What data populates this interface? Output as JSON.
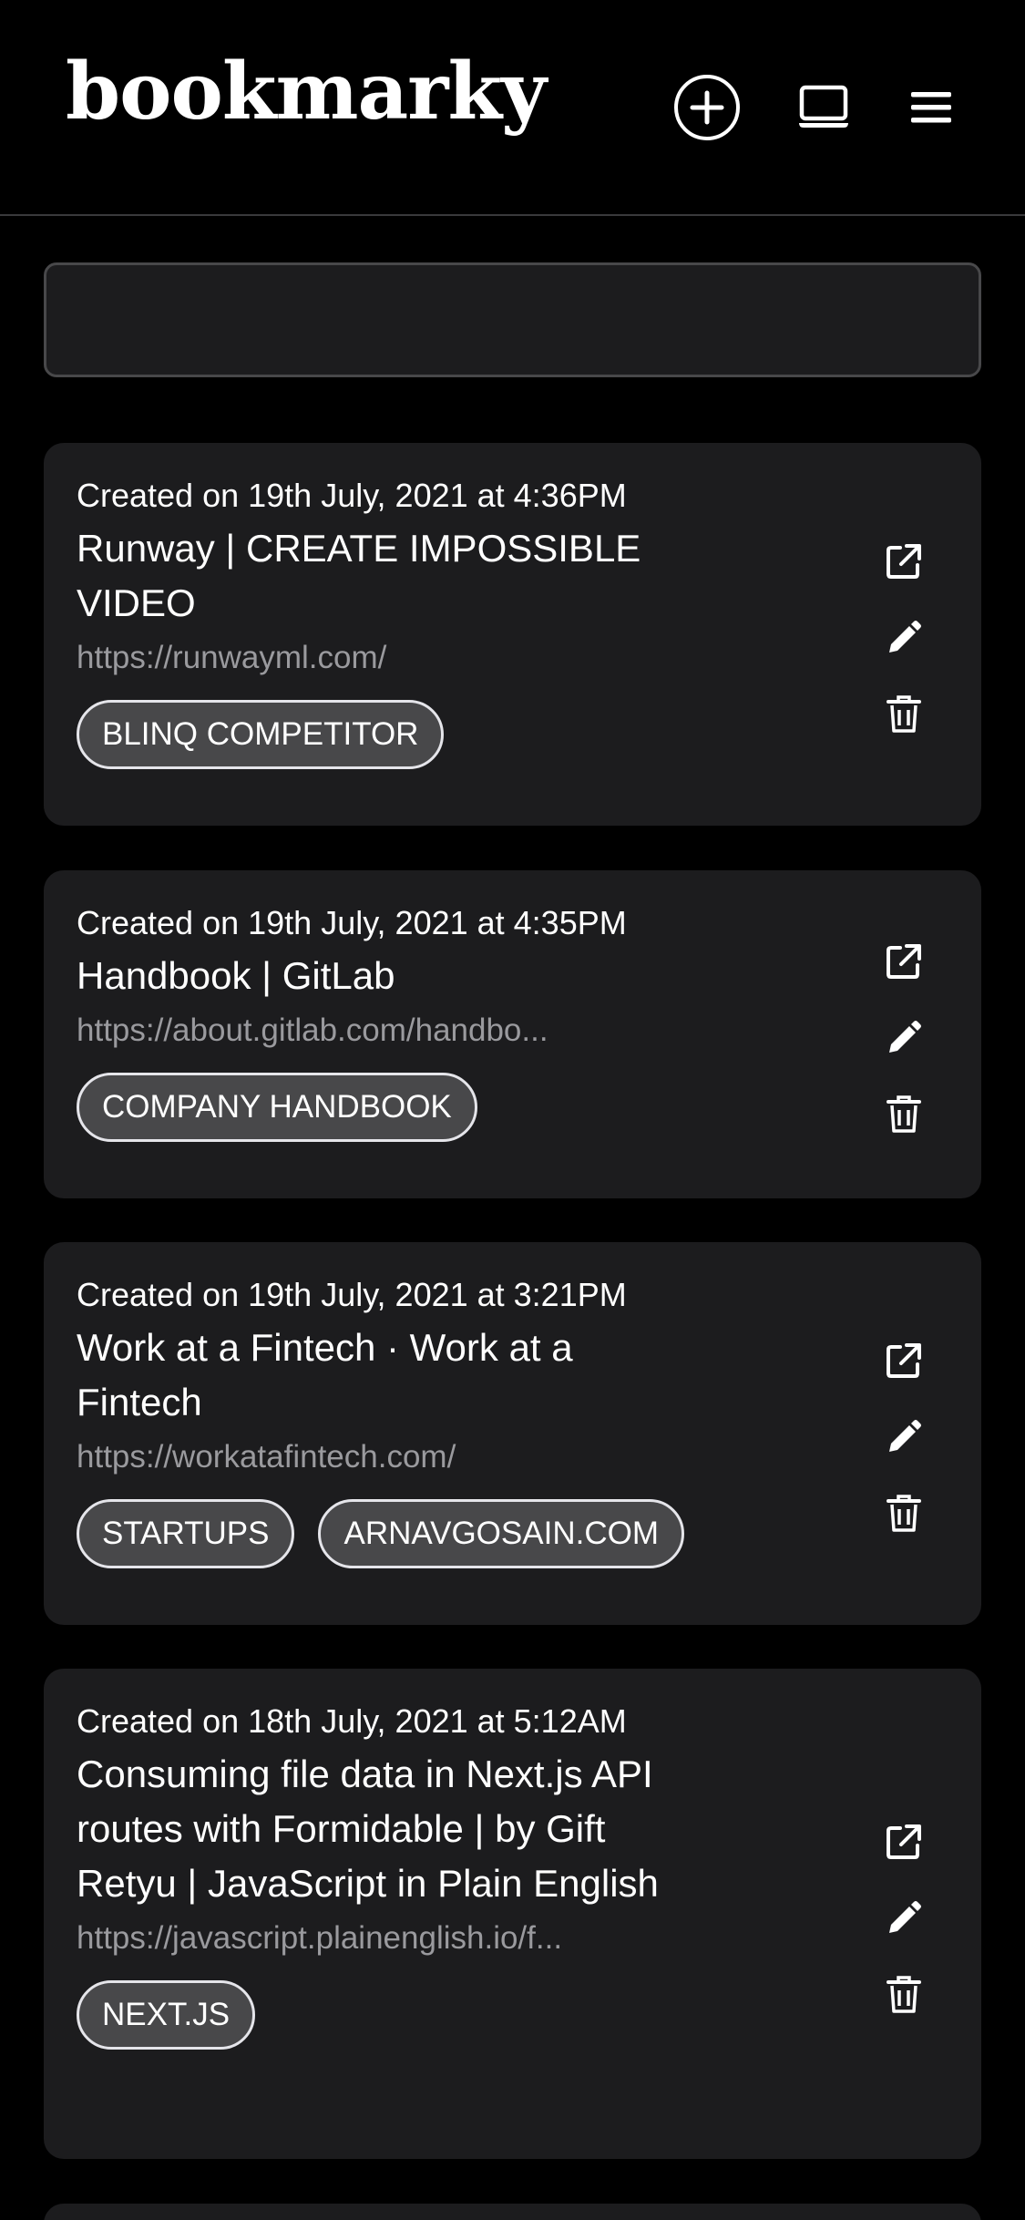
{
  "header": {
    "logo": "bookmarky"
  },
  "search": {
    "value": "",
    "placeholder": ""
  },
  "bookmarks": [
    {
      "created": "Created on 19th July, 2021 at 4:36PM",
      "title": "Runway | CREATE IMPOSSIBLE VIDEO",
      "url": "https://runwayml.com/",
      "tags": [
        "BLINQ COMPETITOR"
      ]
    },
    {
      "created": "Created on 19th July, 2021 at 4:35PM",
      "title": "Handbook | GitLab",
      "url": "https://about.gitlab.com/handbo...",
      "tags": [
        "COMPANY HANDBOOK"
      ]
    },
    {
      "created": "Created on 19th July, 2021 at 3:21PM",
      "title": "Work at a Fintech · Work at a Fintech",
      "url": "https://workatafintech.com/",
      "tags": [
        "STARTUPS",
        "ARNAVGOSAIN.COM"
      ]
    },
    {
      "created": "Created on 18th July, 2021 at 5:12AM",
      "title": "Consuming file data in Next.js API routes with Formidable | by Gift Retyu | JavaScript in Plain English",
      "url": "https://javascript.plainenglish.io/f...",
      "tags": [
        "NEXT.JS"
      ]
    }
  ],
  "icons": {
    "add": "plus-circle-icon",
    "view": "laptop-icon",
    "menu": "hamburger-menu-icon",
    "open": "external-link-icon",
    "edit": "pencil-icon",
    "delete": "trash-icon"
  },
  "colors": {
    "background": "#000000",
    "card": "#1c1c1e",
    "tag_bg": "#48484a",
    "muted_text": "#9a9a9e"
  }
}
